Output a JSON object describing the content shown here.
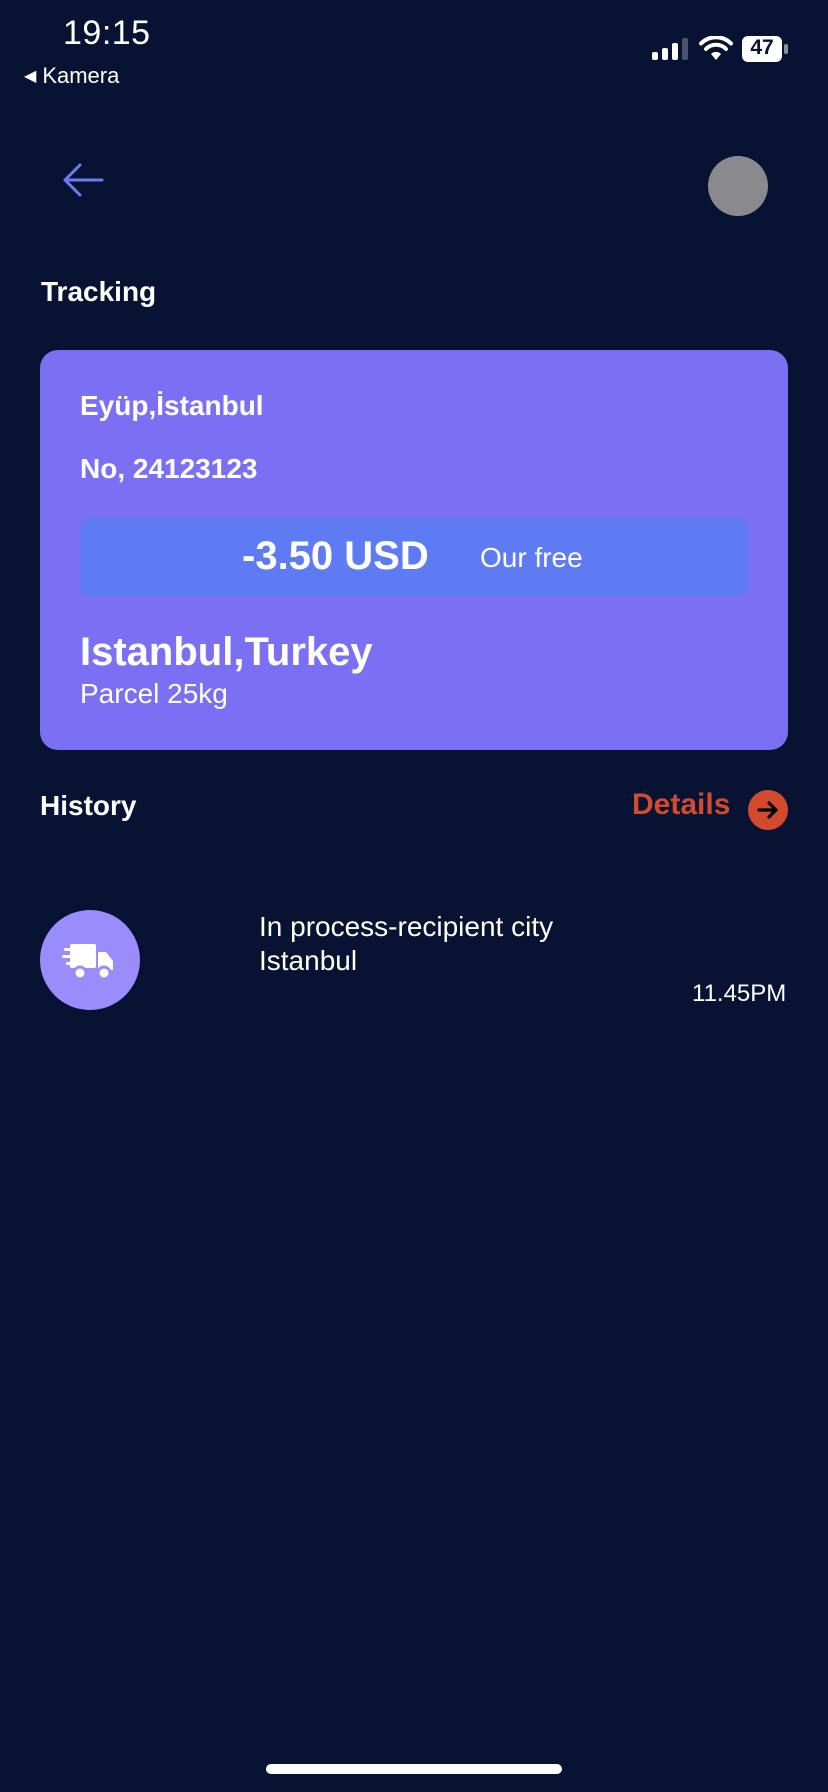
{
  "status_bar": {
    "time": "19:15",
    "back_app": "Kamera",
    "battery": "47"
  },
  "header": {
    "title": "Tracking"
  },
  "card": {
    "location": "Eyüp,İstanbul",
    "number": "No, 24123123",
    "amount": "-3.50 USD",
    "fee_label": "Our free",
    "city": "Istanbul,Turkey",
    "parcel": "Parcel 25kg"
  },
  "history": {
    "title": "History",
    "details_label": "Details",
    "items": [
      {
        "line1": "In process-recipient city",
        "line2": "Istanbul",
        "time": "11.45PM",
        "icon": "delivery-truck-icon"
      }
    ]
  },
  "colors": {
    "background": "#081232",
    "card": "#7b70f4",
    "price_box": "#5f7bf3",
    "accent_red": "#d34a2f",
    "icon_circle": "#9a8cfb"
  }
}
